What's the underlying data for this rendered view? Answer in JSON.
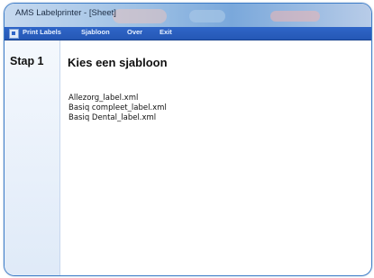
{
  "window": {
    "title": "AMS Labelprinter - [Sheet]"
  },
  "menu": {
    "items": [
      {
        "label": "Print Labels"
      },
      {
        "label": "Sjabloon"
      },
      {
        "label": "Over"
      },
      {
        "label": "Exit"
      }
    ]
  },
  "sidebar": {
    "step_label": "Stap 1"
  },
  "main": {
    "heading": "Kies een sjabloon",
    "templates": [
      "Allezorg_label.xml",
      "Basiq compleet_label.xml",
      "Basiq Dental_label.xml"
    ]
  },
  "colors": {
    "menubar": "#2f66c8",
    "window_border": "#3f7ec8",
    "sidebar": "#e8f0fb"
  },
  "icons": {
    "app": "app-window-icon"
  }
}
